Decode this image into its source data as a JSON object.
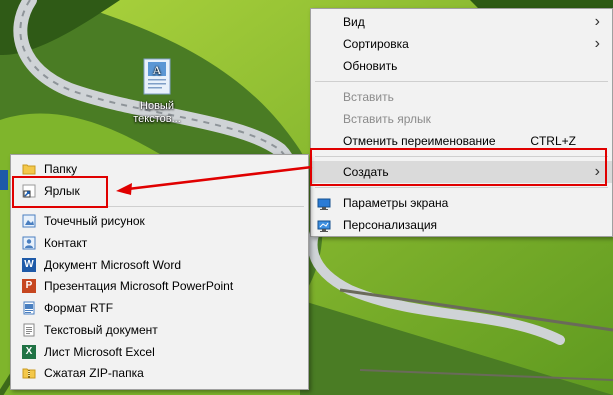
{
  "desktop_icon": {
    "label_line1": "Новый",
    "label_line2": "текстов...",
    "icon_name": "text-document-icon"
  },
  "context_menu": {
    "items": [
      {
        "label": "Вид",
        "has_submenu": true,
        "enabled": true
      },
      {
        "label": "Сортировка",
        "has_submenu": true,
        "enabled": true
      },
      {
        "label": "Обновить",
        "enabled": true
      },
      {
        "label": "Вставить",
        "enabled": false
      },
      {
        "label": "Вставить ярлык",
        "enabled": false
      },
      {
        "label": "Отменить переименование",
        "shortcut": "CTRL+Z",
        "enabled": true
      },
      {
        "label": "Создать",
        "has_submenu": true,
        "highlighted": true,
        "enabled": true
      },
      {
        "label": "Параметры экрана",
        "icon": "display-settings-icon",
        "enabled": true
      },
      {
        "label": "Персонализация",
        "icon": "personalization-icon",
        "enabled": true
      }
    ]
  },
  "create_submenu": {
    "items": [
      {
        "label": "Папку",
        "icon": "folder-icon"
      },
      {
        "label": "Ярлык",
        "icon": "shortcut-icon",
        "highlighted": true
      },
      {
        "label": "Точечный рисунок",
        "icon": "bitmap-icon"
      },
      {
        "label": "Контакт",
        "icon": "contact-icon"
      },
      {
        "label": "Документ Microsoft Word",
        "icon": "word-icon"
      },
      {
        "label": "Презентация Microsoft PowerPoint",
        "icon": "powerpoint-icon"
      },
      {
        "label": "Формат RTF",
        "icon": "rtf-icon"
      },
      {
        "label": "Текстовый документ",
        "icon": "text-document-icon"
      },
      {
        "label": "Лист Microsoft Excel",
        "icon": "excel-icon"
      },
      {
        "label": "Сжатая ZIP-папка",
        "icon": "zip-folder-icon"
      }
    ]
  },
  "colors": {
    "highlight_red": "#e00000",
    "menu_bg": "#f2f2f2",
    "hover_bg": "#dadada"
  }
}
